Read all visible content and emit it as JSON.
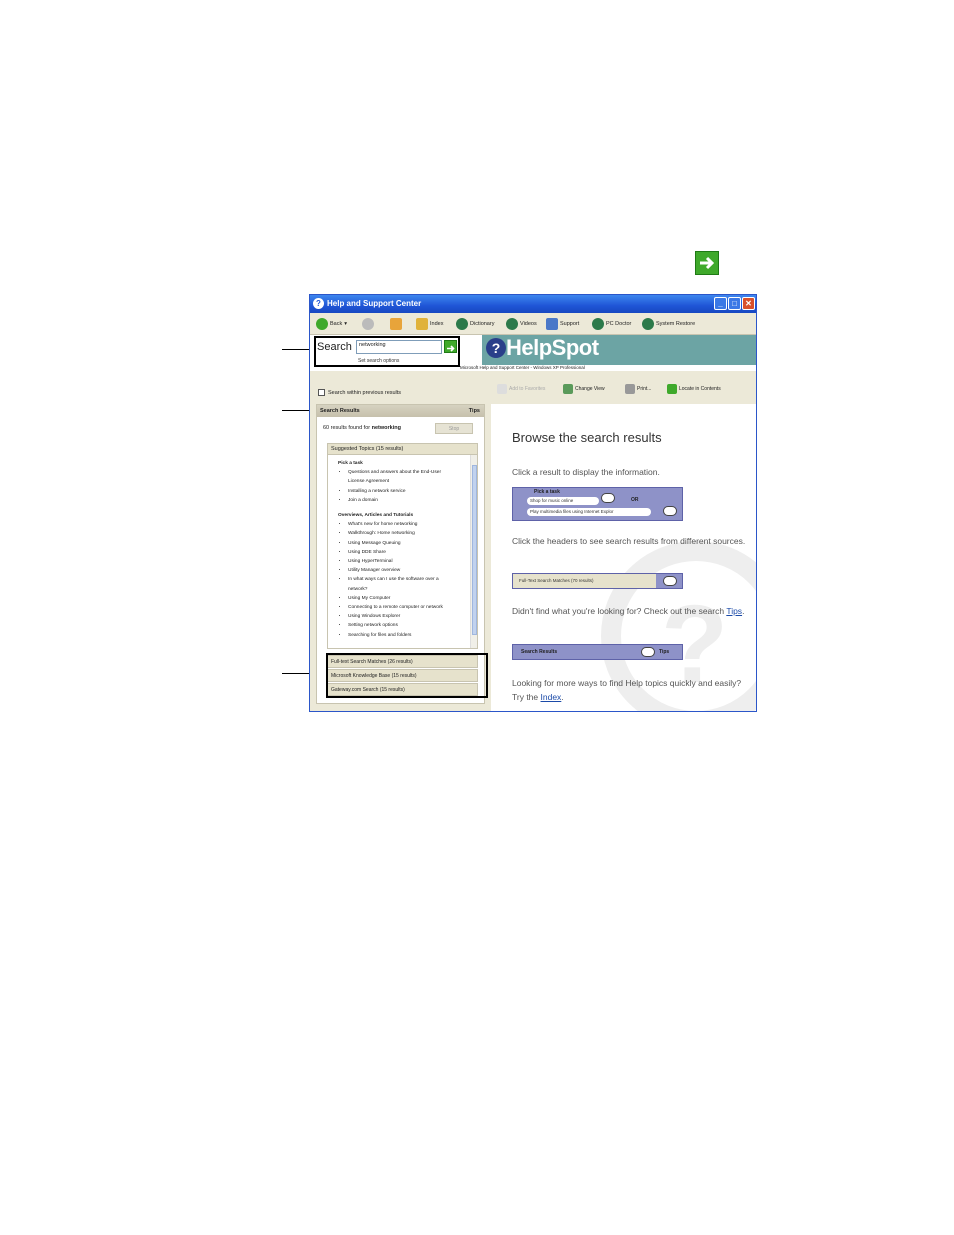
{
  "window": {
    "title": "Help and Support Center"
  },
  "toolbar": {
    "back": "Back",
    "index": "Index",
    "dictionary": "Dictionary",
    "videos": "Videos",
    "support": "Support",
    "pc_doctor": "PC Doctor",
    "system_restore": "System Restore"
  },
  "search": {
    "label": "Search",
    "value": "networking",
    "options_link": "Set search options",
    "within_previous": "Search within previous results"
  },
  "brand": {
    "name": "HelpSpot",
    "subtitle": "Microsoft Help and Support Center - Windows XP Professional"
  },
  "results": {
    "header": "Search Results",
    "tips": "Tips",
    "count_prefix": "60 results found for",
    "query": "networking",
    "stop": "Stop",
    "suggested_title": "Suggested Topics (15 results)",
    "groups": [
      {
        "title": "Pick a task",
        "items": [
          "Questions and answers about the End-User",
          "License Agreement",
          "Installing a network service",
          "Join a domain"
        ]
      },
      {
        "title": "Overviews, Articles and Tutorials",
        "items": [
          "What's new for home networking",
          "Walkthrough: Home networking",
          "Using Message Queuing",
          "Using DDE Share",
          "Using HyperTerminal",
          "Utility Manager overview",
          "In what ways can I use the software over a",
          "network?",
          "Using My Computer",
          "Connecting to a remote computer or network",
          "Using Windows Explorer",
          "Setting network options",
          "Searching for files and folders"
        ]
      }
    ],
    "sources": [
      "Full-text Search Matches (26 results)",
      "Microsoft Knowledge Base (15 results)",
      "Gateway.com Search (15 results)"
    ]
  },
  "right_toolbar": {
    "add_favorites": "Add to Favorites",
    "change_view": "Change View",
    "print": "Print...",
    "locate": "Locate in Contents"
  },
  "content": {
    "title": "Browse the search results",
    "p1": "Click a result to display the information.",
    "demo1_title": "Pick a task",
    "demo1_item1": "Shop for music online",
    "demo1_or": "OR",
    "demo1_item2": "Play multimedia files using Internet Explor",
    "p2": "Click the headers to see search results from different sources.",
    "demo2_label": "Full-Text Search Matches (70 results)",
    "p3_prefix": "Didn't find what you're looking for? Check out the search",
    "p3_link": "Tips",
    "p3_suffix": ".",
    "demo3_label": "Search Results",
    "demo3_tips": "Tips",
    "p4_prefix": "Looking for more ways to find Help topics quickly and easily? Try the",
    "p4_link": "Index",
    "p4_suffix": "."
  },
  "colors": {
    "title_bar": "#1f55d6",
    "brand_band": "#6ca4a4",
    "go_green": "#3fa92b",
    "panel_bg": "#ece9d8",
    "demo_purple": "#8e92c8"
  }
}
